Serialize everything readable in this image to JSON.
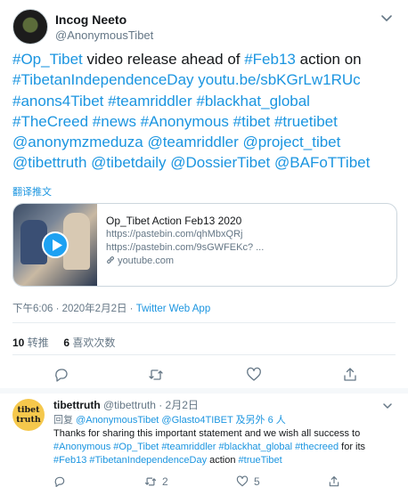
{
  "tweet": {
    "name": "Incog Neeto",
    "handle": "@AnonymousTibet",
    "lines": [
      [
        {
          "t": "#Op_Tibet",
          "link": true
        },
        {
          "t": " video release ahead of ",
          "link": false
        },
        {
          "t": "#Feb13",
          "link": true
        },
        {
          "t": " action on",
          "link": false
        }
      ],
      [
        {
          "t": "#TibetanIndependenceDay",
          "link": true
        },
        {
          "t": " ",
          "link": false
        },
        {
          "t": "youtu.be/sbKGrLw1RUc",
          "link": true
        }
      ],
      [
        {
          "t": "#anons4Tibet",
          "link": true
        },
        {
          "t": " ",
          "link": false
        },
        {
          "t": "#teamriddler",
          "link": true
        },
        {
          "t": " ",
          "link": false
        },
        {
          "t": "#blackhat_global",
          "link": true
        }
      ],
      [
        {
          "t": "#TheCreed",
          "link": true
        },
        {
          "t": " ",
          "link": false
        },
        {
          "t": "#news",
          "link": true
        },
        {
          "t": " ",
          "link": false
        },
        {
          "t": "#Anonymous",
          "link": true
        },
        {
          "t": " ",
          "link": false
        },
        {
          "t": "#tibet",
          "link": true
        },
        {
          "t": " ",
          "link": false
        },
        {
          "t": "#truetibet",
          "link": true
        }
      ],
      [
        {
          "t": "@anonymzmeduza",
          "link": true
        },
        {
          "t": " ",
          "link": false
        },
        {
          "t": "@teamriddler",
          "link": true
        },
        {
          "t": " ",
          "link": false
        },
        {
          "t": "@project_tibet",
          "link": true
        }
      ],
      [
        {
          "t": "@tibettruth",
          "link": true
        },
        {
          "t": " ",
          "link": false
        },
        {
          "t": "@tibetdaily",
          "link": true
        },
        {
          "t": " ",
          "link": false
        },
        {
          "t": "@DossierTibet",
          "link": true
        },
        {
          "t": " ",
          "link": false
        },
        {
          "t": "@BAFoTTibet",
          "link": true
        }
      ]
    ],
    "translate": "翻译推文",
    "card": {
      "title": "Op_Tibet Action Feb13 2020",
      "line1": "https://pastebin.com/qhMbxQRj",
      "line2": "https://pastebin.com/9sGWFEKc? ...",
      "domain": "youtube.com"
    },
    "time": "下午6:06 · 2020年2月2日 · ",
    "source": "Twitter Web App",
    "retweets_count": "10",
    "retweets_label": "转推",
    "likes_count": "6",
    "likes_label": "喜欢次数"
  },
  "reply": {
    "name": "tibettruth",
    "handle": "@tibettruth",
    "date": "· 2月2日",
    "avatar_line1": "tibet",
    "avatar_line2": "truth",
    "replying_prefix": "回复 ",
    "replying_to": "@AnonymousTibet @Glasto4TIBET",
    "replying_suffix": " 及另外 6 人",
    "text_line1": "Thanks for sharing this important statement and we wish all success to",
    "text_line2": [
      {
        "t": "#Anonymous",
        "link": true
      },
      {
        "t": " ",
        "link": false
      },
      {
        "t": "#Op_Tibet",
        "link": true
      },
      {
        "t": " ",
        "link": false
      },
      {
        "t": "#teamriddler",
        "link": true
      },
      {
        "t": " ",
        "link": false
      },
      {
        "t": "#blackhat_global",
        "link": true
      },
      {
        "t": " ",
        "link": false
      },
      {
        "t": "#thecreed",
        "link": true
      },
      {
        "t": " for its",
        "link": false
      }
    ],
    "text_line3": [
      {
        "t": "#Feb13",
        "link": true
      },
      {
        "t": " ",
        "link": false
      },
      {
        "t": "#TibetanIndependenceDay",
        "link": true
      },
      {
        "t": " action ",
        "link": false
      },
      {
        "t": "#trueTibet",
        "link": true
      }
    ],
    "retweets": "2",
    "likes": "5"
  },
  "icons": {
    "reply": "reply-icon",
    "retweet": "retweet-icon",
    "like": "heart-icon",
    "share": "share-icon",
    "chevron": "chevron-down-icon",
    "play": "play-icon",
    "link": "link-icon"
  },
  "colors": {
    "link": "#1b95e0",
    "muted": "#657786",
    "play": "#1da1f2"
  }
}
